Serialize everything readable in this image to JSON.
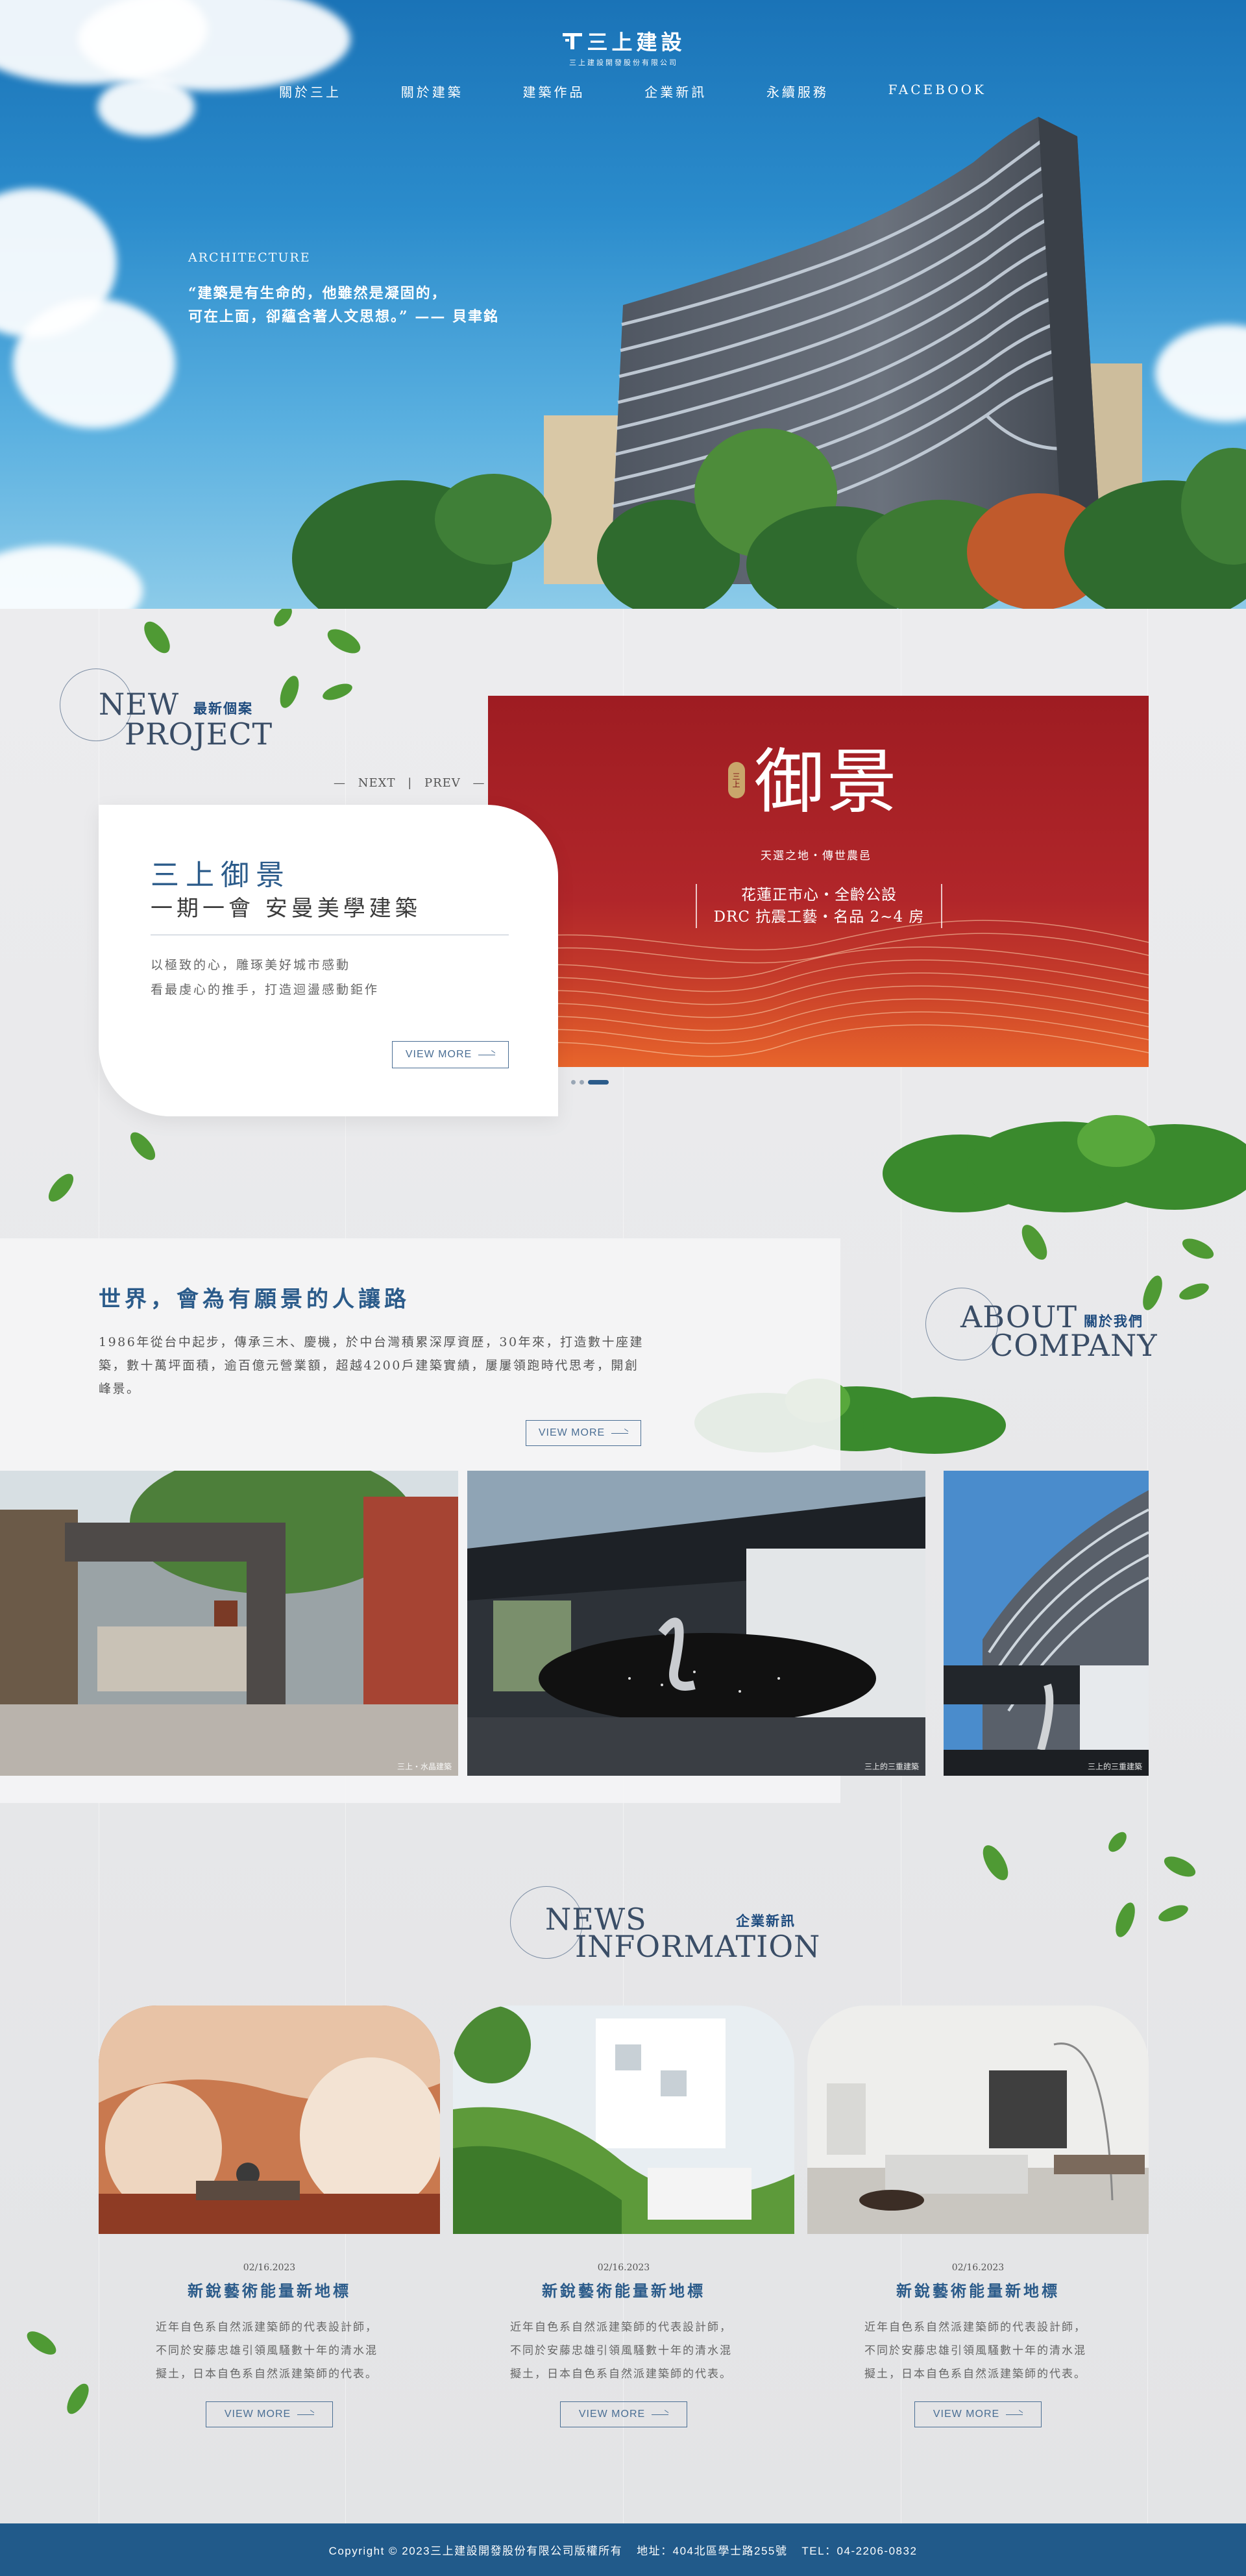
{
  "brand": {
    "logo_name": "三上建設",
    "logo_sub": "三上建設開發股份有限公司"
  },
  "nav": {
    "items": [
      "關於三上",
      "關於建築",
      "建築作品",
      "企業新訊",
      "永續服務",
      "FACEBOOK"
    ]
  },
  "hero": {
    "kicker": "ARCHITECTURE",
    "quote_line1": "“建築是有生命的，他雖然是凝固的，",
    "quote_line2": "可在上面，卻蘊含著人文思想。” —— 貝聿銘"
  },
  "new_project": {
    "title_en_1": "NEW",
    "title_en_2": "PROJECT",
    "title_cn": "最新個案",
    "next_label": "NEXT",
    "prev_label": "PREV",
    "name": "三上御景",
    "headline": "一期一會 安曼美學建築",
    "desc_line1": "以極致的心，雕琢美好城市感動",
    "desc_line2": "看最虔心的推手，打造迴盪感動鉅作",
    "button_label": "VIEW MORE",
    "banner": {
      "seal": "三上",
      "brand": "御景",
      "slogan": "天選之地・傳世農邑",
      "feature_line1": "花蓮正市心・全齡公設",
      "feature_line2": "DRC 抗震工藝・名品 2~4 房"
    },
    "slides_total": 3,
    "slide_active": 3
  },
  "about": {
    "title_en_1": "ABOUT",
    "title_en_2": "COMPANY",
    "title_cn": "關於我們",
    "heading": "世界，會為有願景的人讓路",
    "text": "1986年從台中起步，傳承三木、慶機，於中台灣積累深厚資歷，30年來，打造數十座建築，數十萬坪面積，逾百億元營業額，超越4200戶建築實績，屢屢領跑時代思考，開創峰景。",
    "button_label": "VIEW MORE",
    "photo_captions": [
      "三上・水晶建築",
      "三上的三重建築",
      "三上的三重建築"
    ]
  },
  "news": {
    "title_en_1": "NEWS",
    "title_en_2": "INFORMATION",
    "title_cn": "企業新訊",
    "items": [
      {
        "date": "02/16.2023",
        "title": "新銳藝術能量新地標",
        "body": "近年自色系自然派建築師的代表設計師，不同於安藤忠雄引領風騷數十年的清水混擬土，日本自色系自然派建築師的代表。",
        "button": "VIEW MORE"
      },
      {
        "date": "02/16.2023",
        "title": "新銳藝術能量新地標",
        "body": "近年自色系自然派建築師的代表設計師，不同於安藤忠雄引領風騷數十年的清水混擬土，日本自色系自然派建築師的代表。",
        "button": "VIEW MORE"
      },
      {
        "date": "02/16.2023",
        "title": "新銳藝術能量新地標",
        "body": "近年自色系自然派建築師的代表設計師，不同於安藤忠雄引領風騷數十年的清水混擬土，日本自色系自然派建築師的代表。",
        "button": "VIEW MORE"
      }
    ]
  },
  "footer": {
    "copyright": "Copyright © 2023三上建設開發股份有限公司版權所有",
    "address": "地址：404北區學士路255號",
    "tel": "TEL：04-2206-0832"
  },
  "colors": {
    "primary": "#2b5b8a",
    "footer": "#215a8a",
    "banner_red": "#a81f25"
  }
}
